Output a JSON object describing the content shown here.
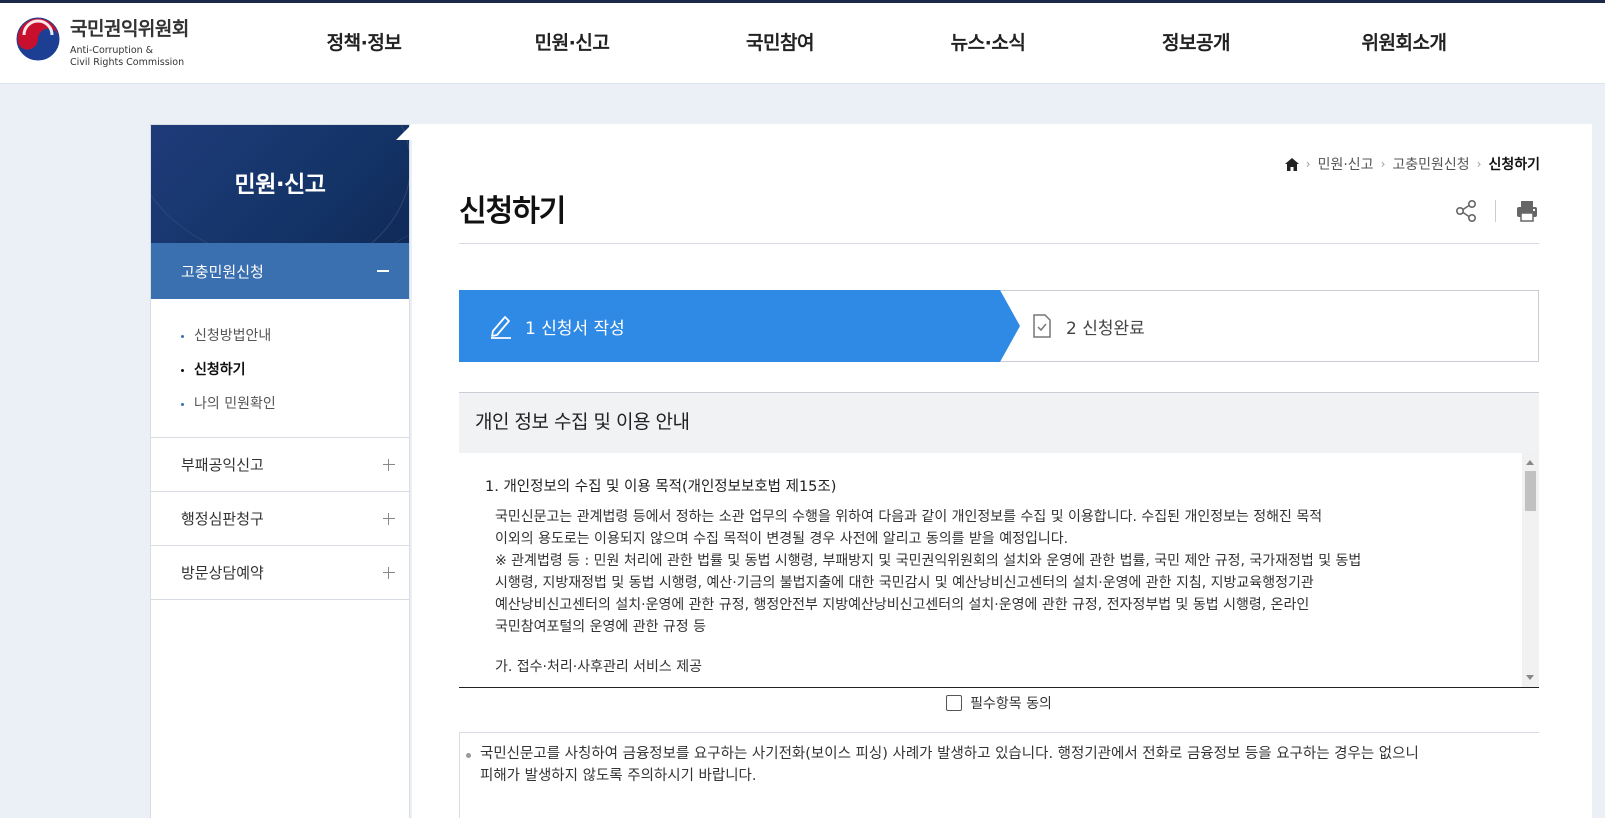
{
  "header": {
    "logo_kr": "국민권익위원회",
    "logo_en_line1": "Anti-Corruption &",
    "logo_en_line2": "Civil Rights Commission",
    "nav": [
      "정책·정보",
      "민원·신고",
      "국민참여",
      "뉴스·소식",
      "정보공개",
      "위원회소개"
    ]
  },
  "sidebar": {
    "title": "민원·신고",
    "active_section": "고충민원신청",
    "sub_items": [
      {
        "label": "신청방법안내",
        "current": false
      },
      {
        "label": "신청하기",
        "current": true
      },
      {
        "label": "나의 민원확인",
        "current": false
      }
    ],
    "sections": [
      "부패공익신고",
      "행정심판청구",
      "방문상담예약"
    ]
  },
  "breadcrumb": {
    "items": [
      "민원·신고",
      "고충민원신청"
    ],
    "current": "신청하기"
  },
  "page_title": "신청하기",
  "steps": {
    "step1": "1 신청서 작성",
    "step2": "2 신청완료"
  },
  "privacy": {
    "title": "개인 정보 수집 및 이용 안내",
    "section_heading": "1. 개인정보의 수집 및 이용 목적(개인정보보호법 제15조)",
    "lines": [
      "국민신문고는 관계법령 등에서 정하는 소관 업무의 수행을 위하여 다음과 같이 개인정보를 수집 및 이용합니다. 수집된 개인정보는 정해진 목적",
      "이외의 용도로는 이용되지 않으며 수집 목적이 변경될 경우 사전에 알리고 동의를 받을 예정입니다.",
      "※ 관계법령 등 : 민원 처리에 관한 법률 및 동법 시행령, 부패방지 및 국민권익위원회의 설치와 운영에 관한 법률, 국민 제안 규정, 국가재정법 및 동법",
      "시행령, 지방재정법 및 동법 시행령, 예산·기금의 불법지출에 대한 국민감시 및 예산낭비신고센터의 설치·운영에 관한 지침, 지방교육행정기관",
      "예산낭비신고센터의 설치·운영에 관한 규정, 행정안전부 지방예산낭비신고센터의 설치·운영에 관한 규정, 전자정부법 및 동법 시행령, 온라인",
      "국민참여포털의 운영에 관한 규정 등"
    ],
    "sub_heading": "가. 접수·처리·사후관리 서비스 제공"
  },
  "agree_label": "필수항목 동의",
  "notice": {
    "line1": "국민신문고를 사칭하여 금융정보를 요구하는 사기전화(보이스 피싱) 사례가 발생하고 있습니다. 행정기관에서 전화로 금융정보 등을 요구하는 경우는 없으니",
    "line2": "피해가 발생하지 않도록 주의하시기 바랍니다."
  },
  "colors": {
    "accent": "#2f8ae6",
    "sidebar_active": "#3a6fb0",
    "sidebar_title": "#143468"
  }
}
